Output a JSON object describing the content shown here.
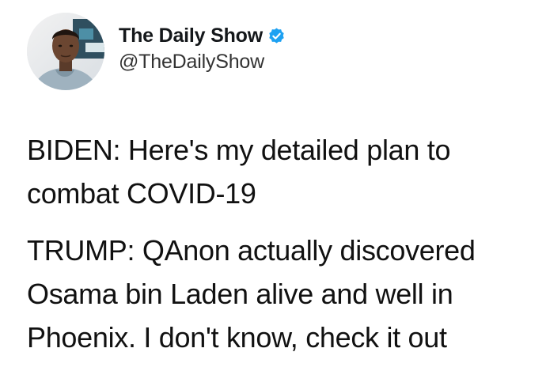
{
  "tweet": {
    "display_name": "The Daily Show",
    "handle": "@TheDailyShow",
    "verified": true,
    "paragraphs": [
      "BIDEN: Here's my detailed plan to combat COVID-19",
      "TRUMP: QAnon actually discovered Osama bin Laden alive and well in Phoenix. I don't know, check it out"
    ]
  },
  "colors": {
    "verified_badge": "#1da1f2",
    "text": "#111111",
    "background": "#ffffff"
  },
  "icons": {
    "verified": "verified-badge-icon"
  }
}
